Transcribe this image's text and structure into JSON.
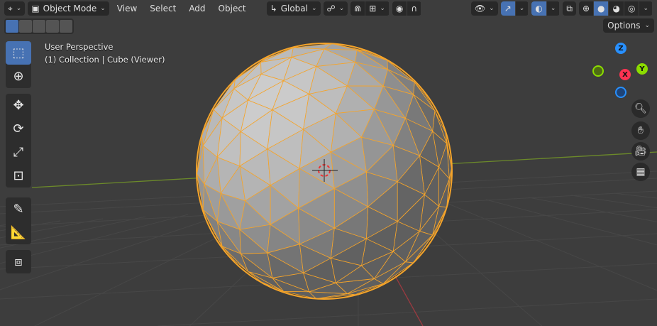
{
  "header": {
    "mode": "Object Mode",
    "menus": [
      "View",
      "Select",
      "Add",
      "Object"
    ],
    "orientation": "Global"
  },
  "options_label": "Options",
  "overlay": {
    "view_name": "User Perspective",
    "context": "(1) Collection | Cube (Viewer)"
  },
  "gizmo": {
    "x": "X",
    "y": "Y",
    "z": "Z"
  },
  "colors": {
    "accent": "#4772b3",
    "selection": "#f5a42a",
    "x_axis": "#ff3352",
    "y_axis": "#8bdc00",
    "z_axis": "#2890ff"
  },
  "tools": [
    "select-box",
    "cursor",
    "move",
    "rotate",
    "scale",
    "transform",
    "annotate",
    "measure",
    "add-cube"
  ]
}
